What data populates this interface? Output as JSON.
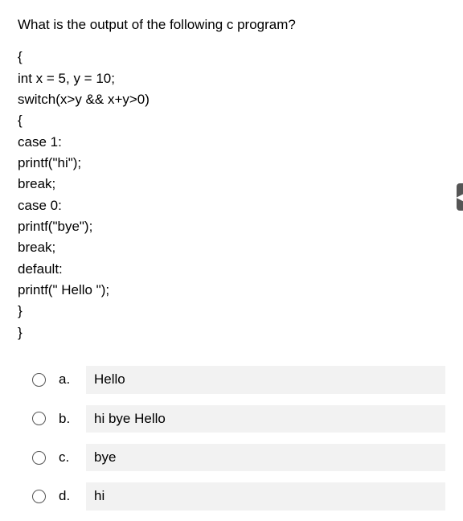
{
  "question": "What is the output of the following c program?",
  "code": "{\nint x = 5, y = 10;\nswitch(x>y && x+y>0)\n{\ncase 1:\nprintf(\"hi\");\nbreak;\ncase 0:\nprintf(\"bye\");\nbreak;\ndefault:\nprintf(\" Hello \");\n}\n}",
  "options": [
    {
      "letter": "a.",
      "text": "Hello"
    },
    {
      "letter": "b.",
      "text": "hi bye Hello"
    },
    {
      "letter": "c.",
      "text": "bye"
    },
    {
      "letter": "d.",
      "text": "hi"
    }
  ],
  "side_glyph": "◀"
}
